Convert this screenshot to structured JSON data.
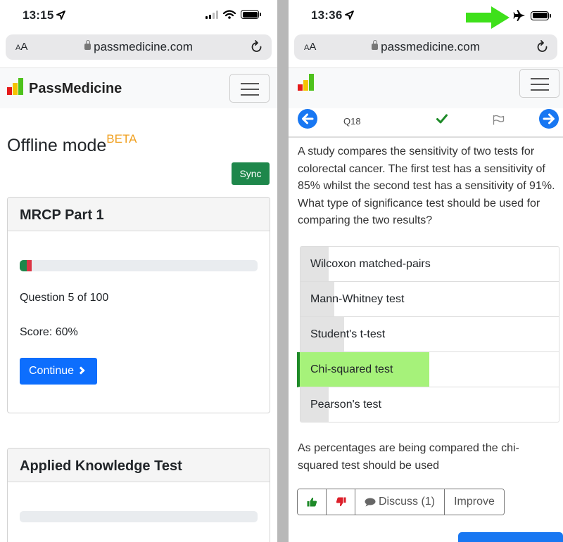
{
  "left": {
    "status": {
      "time": "13:15"
    },
    "url": {
      "aa": "AA",
      "domain": "passmedicine.com"
    },
    "brand": "PassMedicine",
    "offline": {
      "title": "Offline mode",
      "badge": "BETA"
    },
    "sync_label": "Sync",
    "cards": [
      {
        "title": "MRCP Part 1",
        "progress": {
          "correct_fraction": 0.03,
          "incorrect_fraction": 0.02
        },
        "question_text": "Question 5 of 100",
        "score_text": "Score: 60%",
        "continue_label": "Continue"
      },
      {
        "title": "Applied Knowledge Test",
        "progress": {
          "correct_fraction": 0,
          "incorrect_fraction": 0
        }
      }
    ]
  },
  "right": {
    "status": {
      "time": "13:36"
    },
    "url": {
      "aa": "AA",
      "domain": "passmedicine.com"
    },
    "question_number": "Q18",
    "stem": "A study compares the sensitivity of two tests for colorectal cancer. The first test has a sensitivity of 85% whilst the second test has a sensitivity of 91%. What type of significance test should be used for comparing the two results?",
    "answers": [
      {
        "label": "Wilcoxon matched-pairs",
        "share": 0.11,
        "correct": false
      },
      {
        "label": "Mann-Whitney test",
        "share": 0.13,
        "correct": false
      },
      {
        "label": "Student's t-test",
        "share": 0.17,
        "correct": false
      },
      {
        "label": "Chi-squared test",
        "share": 0.5,
        "correct": true
      },
      {
        "label": "Pearson's test",
        "share": 0.11,
        "correct": false
      }
    ],
    "explanation": "As percentages are being compared the chi-squared test should be used",
    "feedback": {
      "discuss_label": "Discuss (1)",
      "improve_label": "Improve"
    }
  },
  "colors": {
    "brand_blue": "#1877f2",
    "success_green": "#1e874b",
    "correct_highlight": "#a6f27a",
    "beta_orange": "#f0a020",
    "annotation_arrow": "#3ee01a"
  },
  "icons": [
    "location-arrow-icon",
    "lock-icon",
    "reload-icon",
    "hamburger-icon",
    "chevron-right-icon",
    "arrow-left-icon",
    "arrow-right-icon",
    "checkmark-icon",
    "flag-icon",
    "thumbs-up-icon",
    "thumbs-down-icon",
    "comment-icon",
    "airplane-icon",
    "battery-icon",
    "wifi-icon",
    "signal-icon"
  ]
}
